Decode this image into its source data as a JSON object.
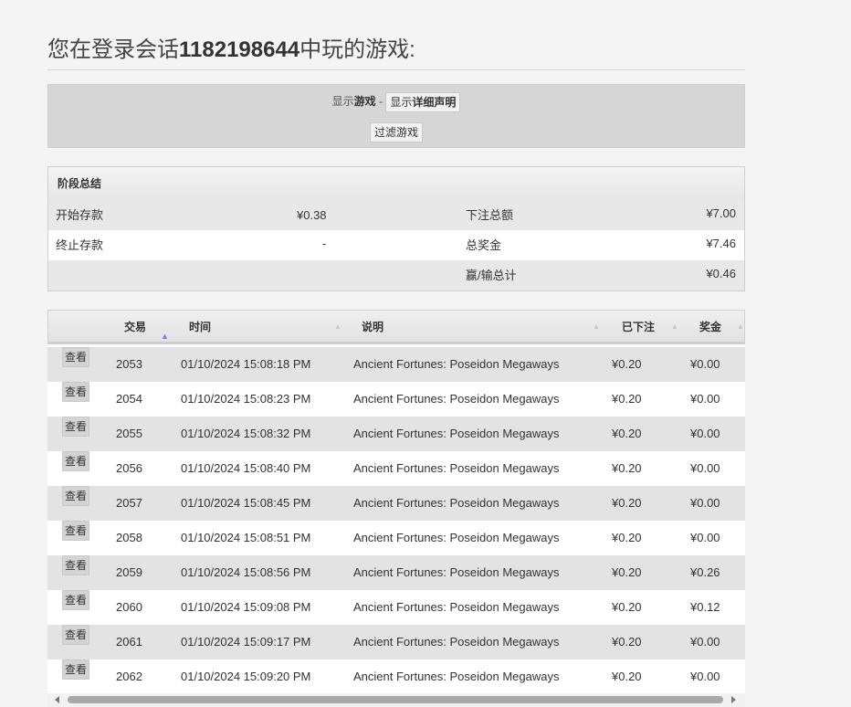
{
  "page": {
    "title_prefix": "您在登录会话",
    "session_id": "1182198644",
    "title_suffix": "中玩的游戏:"
  },
  "toolbar": {
    "show_label_prefix": "显示",
    "show_label_bold": "游戏",
    "separator": " - ",
    "detail_btn_prefix": "显示",
    "detail_btn_bold": "详细声明",
    "filter_btn": "过滤游戏"
  },
  "summary": {
    "header": "阶段总结",
    "start_balance_label": "开始存款",
    "start_balance_value": "¥0.38",
    "total_bet_label": "下注总额",
    "total_bet_value": "¥7.00",
    "end_balance_label": "终止存款",
    "end_balance_value": "-",
    "total_win_label": "总奖金",
    "total_win_value": "¥7.46",
    "net_label": "赢/输总计",
    "net_value": "¥0.46"
  },
  "table": {
    "columns": [
      "交易",
      "时间",
      "说明",
      "已下注",
      "奖金"
    ],
    "view_label": "查看",
    "rows": [
      {
        "id": "2053",
        "time": "01/10/2024 15:08:18 PM",
        "desc": "Ancient Fortunes: Poseidon Megaways",
        "bet": "¥0.20",
        "win": "¥0.00"
      },
      {
        "id": "2054",
        "time": "01/10/2024 15:08:23 PM",
        "desc": "Ancient Fortunes: Poseidon Megaways",
        "bet": "¥0.20",
        "win": "¥0.00"
      },
      {
        "id": "2055",
        "time": "01/10/2024 15:08:32 PM",
        "desc": "Ancient Fortunes: Poseidon Megaways",
        "bet": "¥0.20",
        "win": "¥0.00"
      },
      {
        "id": "2056",
        "time": "01/10/2024 15:08:40 PM",
        "desc": "Ancient Fortunes: Poseidon Megaways",
        "bet": "¥0.20",
        "win": "¥0.00"
      },
      {
        "id": "2057",
        "time": "01/10/2024 15:08:45 PM",
        "desc": "Ancient Fortunes: Poseidon Megaways",
        "bet": "¥0.20",
        "win": "¥0.00"
      },
      {
        "id": "2058",
        "time": "01/10/2024 15:08:51 PM",
        "desc": "Ancient Fortunes: Poseidon Megaways",
        "bet": "¥0.20",
        "win": "¥0.00"
      },
      {
        "id": "2059",
        "time": "01/10/2024 15:08:56 PM",
        "desc": "Ancient Fortunes: Poseidon Megaways",
        "bet": "¥0.20",
        "win": "¥0.26"
      },
      {
        "id": "2060",
        "time": "01/10/2024 15:09:08 PM",
        "desc": "Ancient Fortunes: Poseidon Megaways",
        "bet": "¥0.20",
        "win": "¥0.12"
      },
      {
        "id": "2061",
        "time": "01/10/2024 15:09:17 PM",
        "desc": "Ancient Fortunes: Poseidon Megaways",
        "bet": "¥0.20",
        "win": "¥0.00"
      },
      {
        "id": "2062",
        "time": "01/10/2024 15:09:20 PM",
        "desc": "Ancient Fortunes: Poseidon Megaways",
        "bet": "¥0.20",
        "win": "¥0.00"
      }
    ]
  },
  "colors": {
    "sort_active": "#6f7fd8",
    "row_alt": "#e3e3e3"
  }
}
